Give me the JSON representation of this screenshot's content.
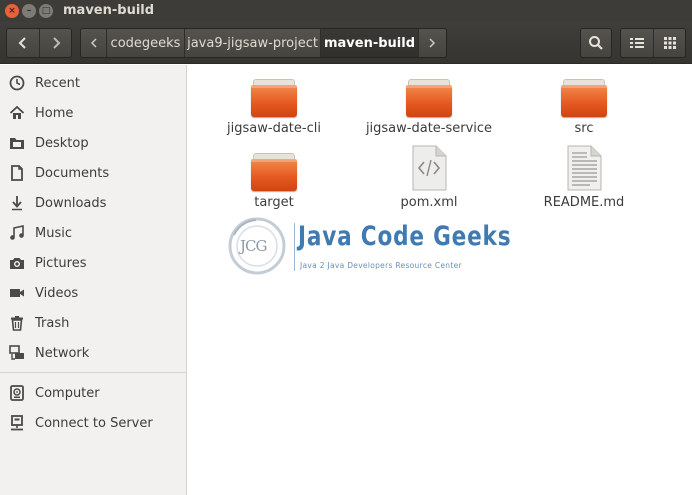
{
  "window": {
    "title": "maven-build",
    "close_glyph": "×",
    "minimize_glyph": "–",
    "maximize_glyph": "□"
  },
  "toolbar": {
    "back_icon": "go-back-icon",
    "forward_icon": "go-forward-icon",
    "path": [
      "codegeeks",
      "java9-jigsaw-project",
      "maven-build"
    ],
    "current_path_index": 2,
    "search_icon": "search-icon",
    "list_view_icon": "list-view-icon",
    "grid_view_icon": "grid-view-icon"
  },
  "sidebar": {
    "places": [
      {
        "label": "Recent",
        "icon": "clock-icon"
      },
      {
        "label": "Home",
        "icon": "home-icon"
      },
      {
        "label": "Desktop",
        "icon": "desktop-folder-icon"
      },
      {
        "label": "Documents",
        "icon": "document-icon"
      },
      {
        "label": "Downloads",
        "icon": "download-icon"
      },
      {
        "label": "Music",
        "icon": "music-icon"
      },
      {
        "label": "Pictures",
        "icon": "camera-icon"
      },
      {
        "label": "Videos",
        "icon": "video-icon"
      },
      {
        "label": "Trash",
        "icon": "trash-icon"
      },
      {
        "label": "Network",
        "icon": "network-icon"
      }
    ],
    "devices": [
      {
        "label": "Computer",
        "icon": "computer-icon"
      },
      {
        "label": "Connect to Server",
        "icon": "server-icon"
      }
    ]
  },
  "files": [
    {
      "name": "jigsaw-date-cli",
      "type": "folder"
    },
    {
      "name": "jigsaw-date-service",
      "type": "folder"
    },
    {
      "name": "src",
      "type": "folder"
    },
    {
      "name": "target",
      "type": "folder"
    },
    {
      "name": "pom.xml",
      "type": "xml"
    },
    {
      "name": "README.md",
      "type": "text"
    }
  ],
  "watermark": {
    "monogram": "JCG",
    "title": "Java Code Geeks",
    "subtitle": "Java 2 Java Developers Resource Center"
  },
  "colors": {
    "titlebar": "#3d3c38",
    "close_button": "#e9603a",
    "folder_orange": "#e4571f",
    "sidebar_bg": "#f2f1f0"
  }
}
